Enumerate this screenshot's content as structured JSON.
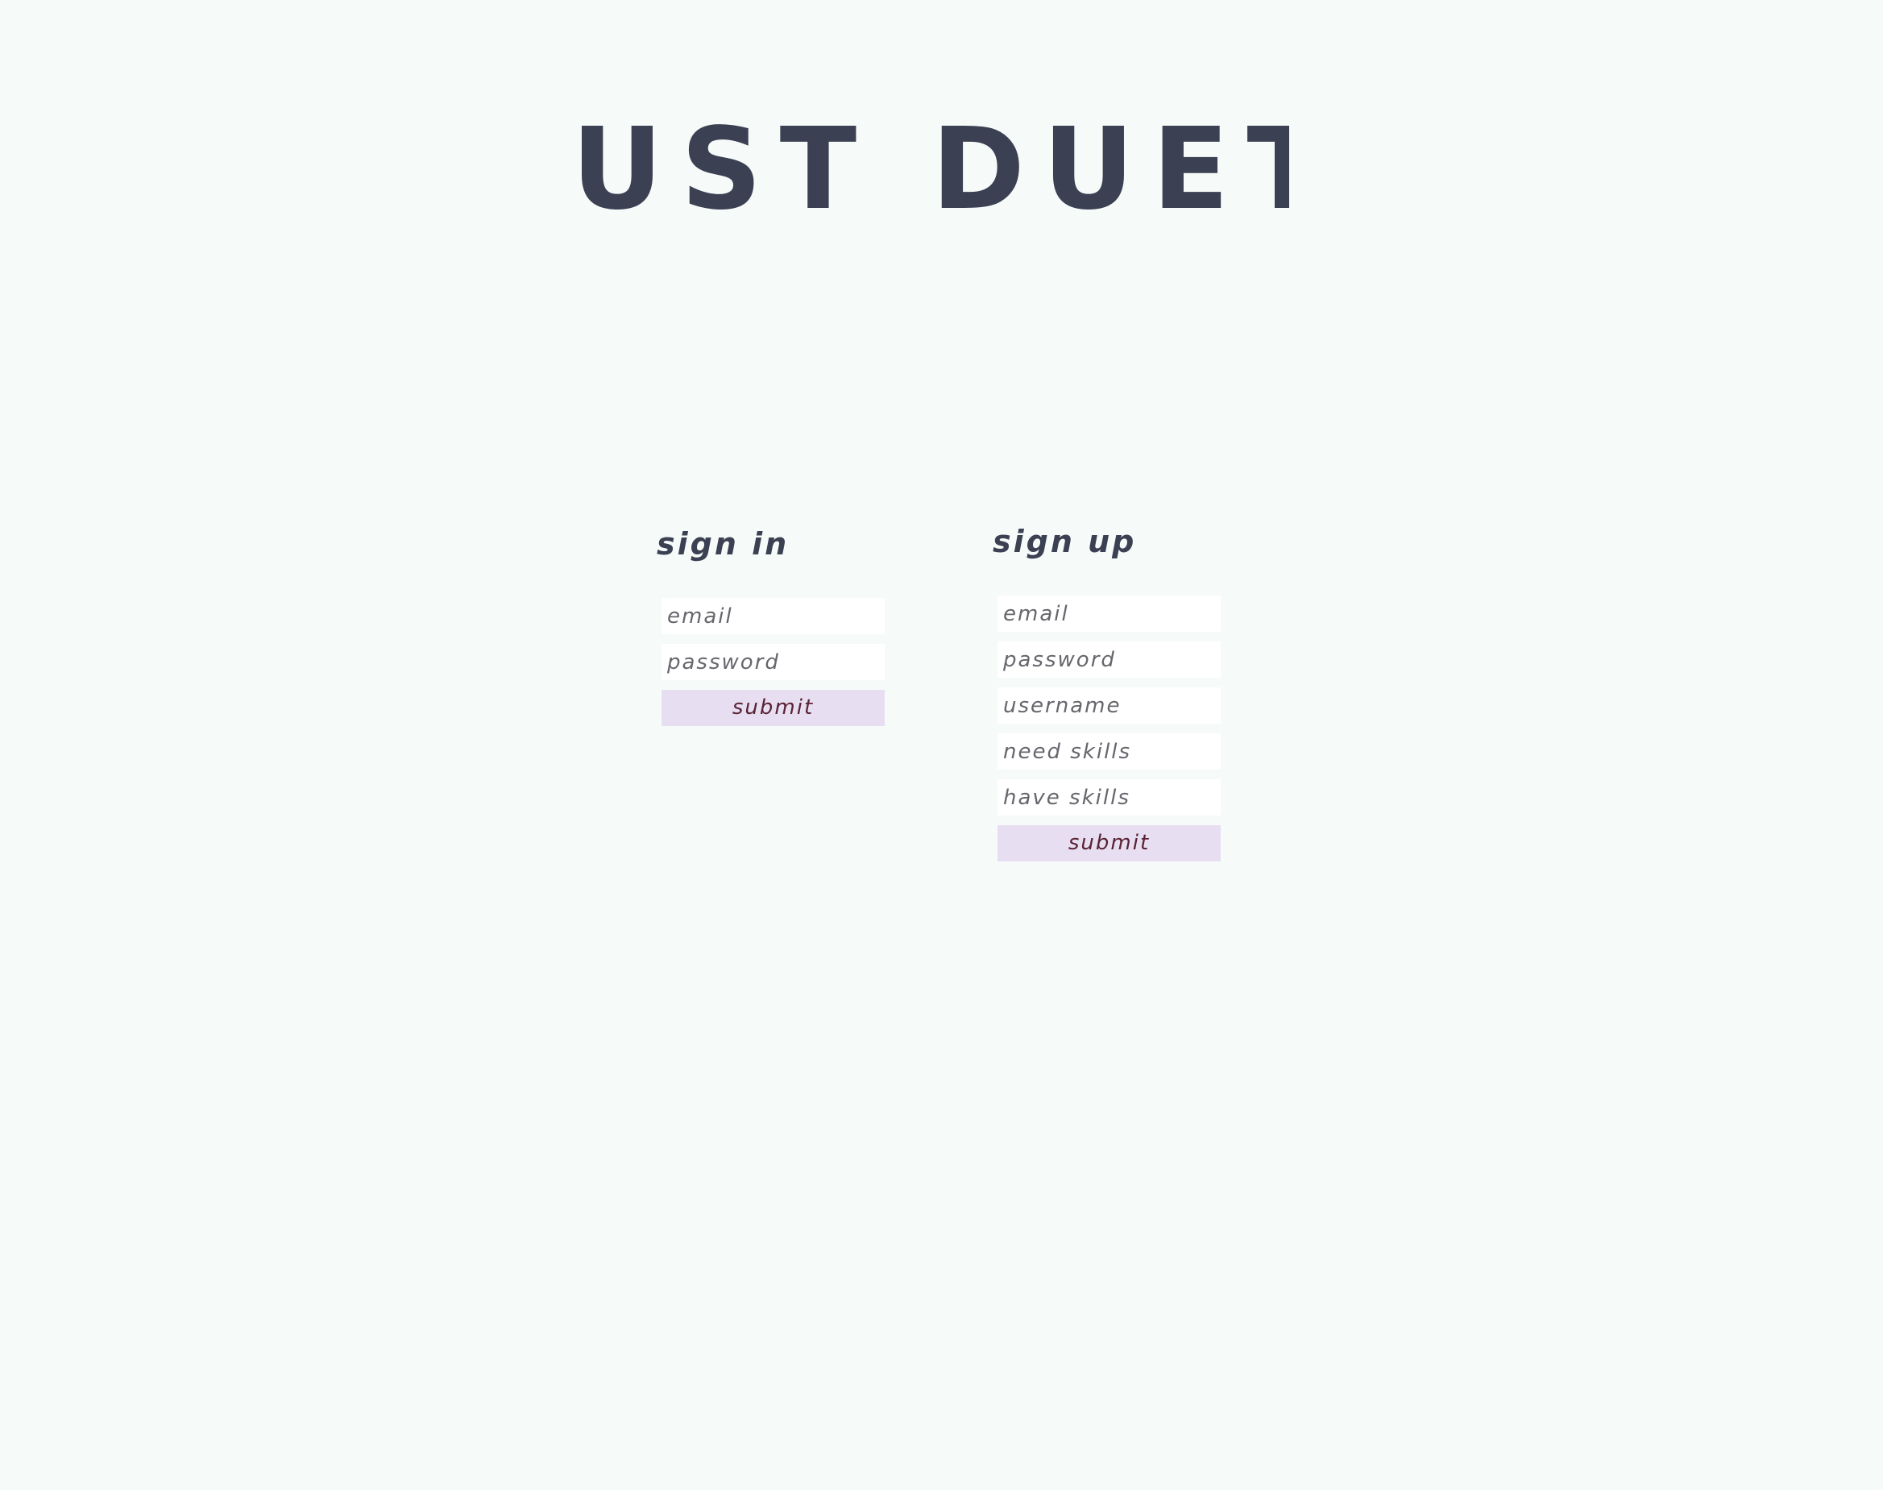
{
  "app": {
    "title": "JUST DUET"
  },
  "sign_in": {
    "title": "sign in",
    "email_placeholder": "email",
    "password_placeholder": "password",
    "submit_label": "submit"
  },
  "sign_up": {
    "title": "sign up",
    "email_placeholder": "email",
    "password_placeholder": "password",
    "username_placeholder": "username",
    "need_skills_placeholder": "need skills",
    "have_skills_placeholder": "have skills",
    "submit_label": "submit"
  },
  "colors": {
    "background": "#f6faf9",
    "text": "#3b4153",
    "submit_bg": "#e7dff1",
    "submit_text": "#5a2234"
  }
}
